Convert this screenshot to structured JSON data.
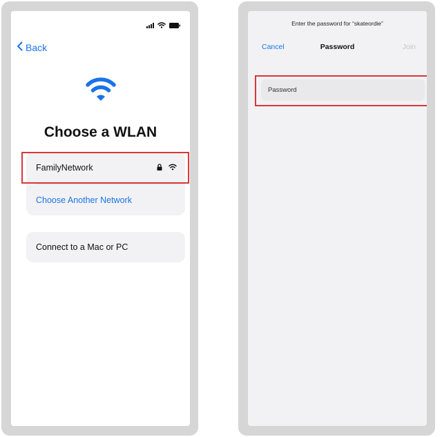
{
  "left_screen": {
    "back_label": "Back",
    "title": "Choose a WLAN",
    "networks": [
      {
        "name": "FamilyNetwork",
        "icons": [
          "lock-icon",
          "wifi-icon"
        ]
      }
    ],
    "choose_another_label": "Choose Another Network",
    "connect_label": "Connect to a Mac or PC",
    "status_icons": [
      "signal-icon",
      "wifi-icon",
      "battery-icon"
    ]
  },
  "right_screen": {
    "prompt": "Enter the password for “skateordie”",
    "cancel_label": "Cancel",
    "title": "Password",
    "join_label": "Join",
    "password_placeholder": "Password"
  },
  "colors": {
    "accent": "#1a73e8",
    "highlight": "#d93636",
    "frame": "#d6d6d6",
    "disabled": "#c4c4c8"
  }
}
